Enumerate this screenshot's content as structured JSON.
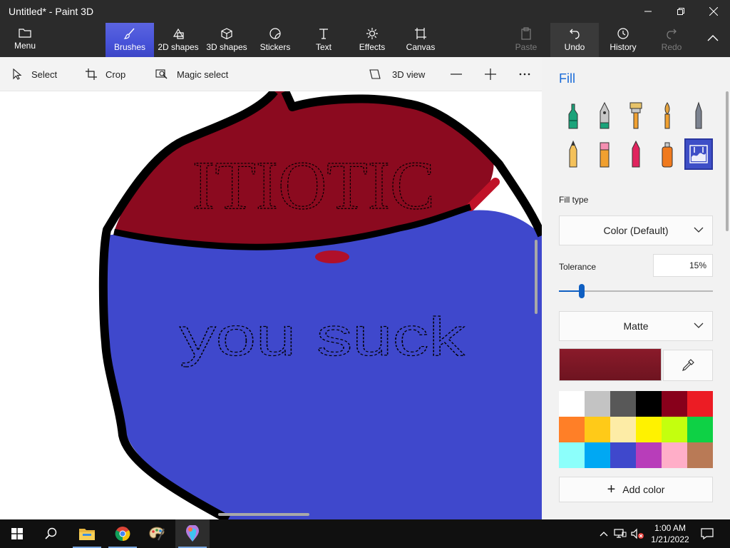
{
  "window": {
    "title": "Untitled* - Paint 3D"
  },
  "ribbon": {
    "menu_label": "Menu",
    "tabs": [
      {
        "label": "Brushes",
        "icon": "brush-icon",
        "active": true
      },
      {
        "label": "2D shapes",
        "icon": "2d-shapes-icon"
      },
      {
        "label": "3D shapes",
        "icon": "3d-shapes-icon"
      },
      {
        "label": "Stickers",
        "icon": "stickers-icon"
      },
      {
        "label": "Text",
        "icon": "text-icon"
      },
      {
        "label": "Effects",
        "icon": "effects-icon"
      },
      {
        "label": "Canvas",
        "icon": "canvas-icon"
      }
    ],
    "paste_label": "Paste",
    "undo_label": "Undo",
    "history_label": "History",
    "redo_label": "Redo"
  },
  "toolbar": {
    "select_label": "Select",
    "crop_label": "Crop",
    "magic_select_label": "Magic select",
    "view3d_label": "3D view"
  },
  "panel": {
    "title": "Fill",
    "brushes": [
      "marker",
      "calligraphy-pen",
      "oil-brush",
      "watercolor",
      "pixel-pen",
      "pencil",
      "eraser",
      "crayon",
      "spray-can",
      "fill"
    ],
    "selected_brush": "fill",
    "fill_type_label": "Fill type",
    "fill_type_value": "Color (Default)",
    "tolerance_label": "Tolerance",
    "tolerance_value": "15%",
    "tolerance_fraction": 0.15,
    "finish_value": "Matte",
    "current_color": "#8a1a2a",
    "palette": [
      "#ffffff",
      "#c3c3c3",
      "#585858",
      "#000000",
      "#88001b",
      "#ec1c24",
      "#ff7f27",
      "#ffca18",
      "#fdeca6",
      "#fff200",
      "#c4ff0e",
      "#0ed145",
      "#8cfffb",
      "#00a8f3",
      "#3f48cc",
      "#b83dba",
      "#ffaec8",
      "#b97a56"
    ],
    "add_color_label": "Add color"
  },
  "canvas": {
    "drawing_text_1": "ITIOTIC",
    "drawing_text_2": "you suck",
    "colors": {
      "body": "#3f48cc",
      "top": "#8b0a1f",
      "outline": "#000000"
    }
  },
  "taskbar": {
    "time": "1:00 AM",
    "date": "1/21/2022"
  }
}
